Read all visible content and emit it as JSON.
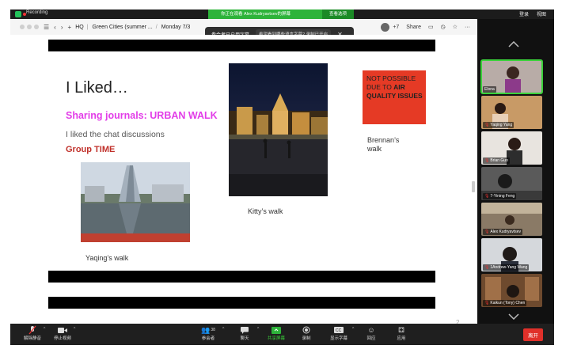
{
  "zoom": {
    "app_name": "Recording",
    "topbar_right": [
      "登录",
      "视图"
    ],
    "share_banner": "你正在观看 Alex Kudryavtsev的屏幕",
    "share_options": "查看选项"
  },
  "browser": {
    "tab_badge": "34",
    "tabs": [
      "HQ",
      "Green Cities (summer ...",
      "Monday 7/3"
    ],
    "participant_extra": "+7",
    "share_label": "Share"
  },
  "caption_popup": {
    "text": "参会者已启用字幕",
    "sub": "希望看到哪些语言字幕? 录制已开启"
  },
  "slide": {
    "title": "I Liked…",
    "journals": "Sharing journals: URBAN WALK",
    "chat": "I liked the chat discussions",
    "group": "Group TIME",
    "redbox_line1": "NOT POSSIBLE DUE TO ",
    "redbox_bold": "AIR QUALITY ISSUES",
    "kitty": "Kitty’s walk",
    "brennan": "Brennan’s walk",
    "yaqing": "Yaqing’s walk"
  },
  "page_number": "2",
  "participants": [
    {
      "name": "Elona",
      "muted": false,
      "active": true
    },
    {
      "name": "Yaqing Yang",
      "muted": true,
      "active": false
    },
    {
      "name": "Brian Guo",
      "muted": true,
      "active": false
    },
    {
      "name": "7-Yining Feng",
      "muted": true,
      "active": false
    },
    {
      "name": "Alex Kudryavtsev",
      "muted": true,
      "active": false
    },
    {
      "name": "1Andrew-Yang Wang",
      "muted": true,
      "active": false
    },
    {
      "name": "Kaikun (Tony) Chen",
      "muted": true,
      "active": false
    }
  ],
  "toolbar": {
    "mute": "解除静音",
    "video": "停止视频",
    "participants": "参会者",
    "participant_count": "38",
    "chat": "聊天",
    "share": "共享屏幕",
    "record": "录制",
    "captions": "显示字幕",
    "reactions": "回应",
    "apps": "应用",
    "leave": "离开"
  },
  "colors": {
    "accent_green": "#2db33a",
    "leave_red": "#e0302a",
    "journal_magenta": "#e23de8",
    "group_red": "#c0302a",
    "redbox": "#e53a25"
  }
}
